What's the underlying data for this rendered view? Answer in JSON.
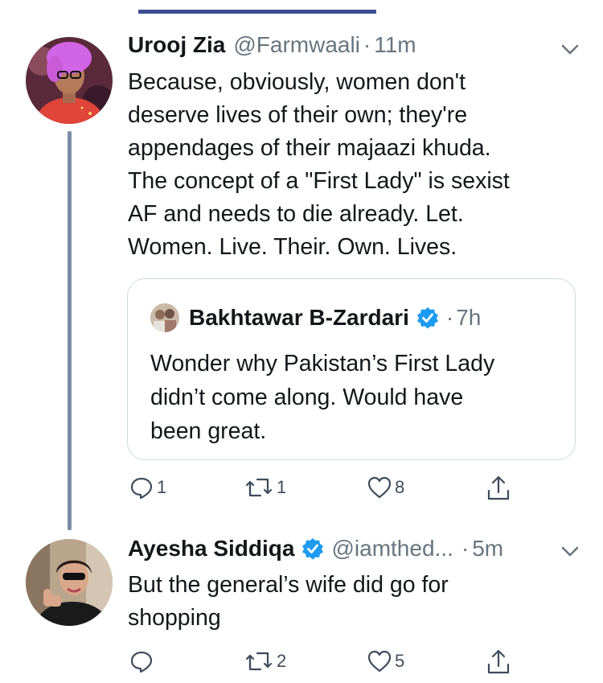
{
  "tweet1": {
    "name": "Urooj Zia",
    "handle": "@Farmwaali",
    "time": "11m",
    "lines": [
      "Because, obviously, women don't",
      "deserve lives of their own; they're",
      "appendages of their majaazi khuda.",
      "The concept of a \"First Lady\" is sexist",
      "AF and needs to die already. Let.",
      "Women. Live. Their. Own. Lives."
    ],
    "replies": "1",
    "retweets": "1",
    "likes": "8"
  },
  "quoted": {
    "name": "Bakhtawar B-Zardari",
    "time": "7h",
    "lines": [
      "Wonder why Pakistan’s First Lady",
      "didn’t come along. Would have",
      "been great."
    ]
  },
  "tweet2": {
    "name": "Ayesha Siddiqa",
    "handle": "@iamthed...",
    "time": "5m",
    "lines": [
      "But the general’s wife did go for",
      "shopping"
    ],
    "retweets": "2",
    "likes": "5"
  },
  "colors": {
    "accent": "#3b4f8e",
    "thread_line": "#7b8da6",
    "text": "#14171a",
    "meta": "#66757f",
    "icon": "#3d4c5c",
    "verified": "#1d9bf0"
  },
  "icons": [
    "chevron-down-icon",
    "verified-badge-icon",
    "reply-icon",
    "retweet-icon",
    "like-icon",
    "share-icon"
  ]
}
